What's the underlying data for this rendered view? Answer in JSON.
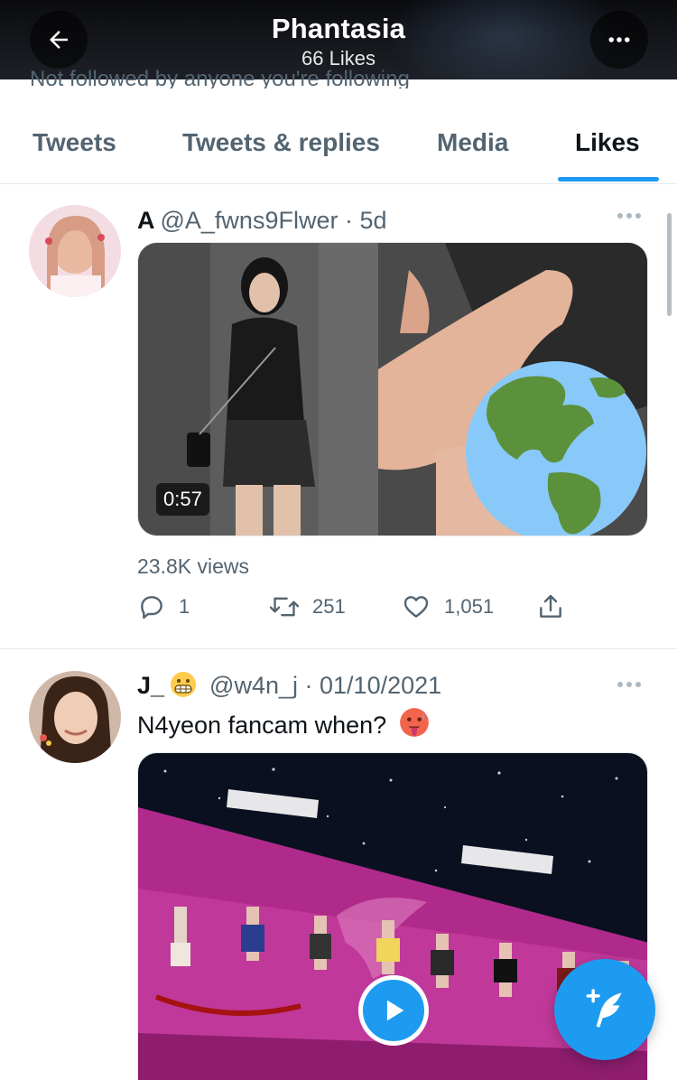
{
  "header": {
    "title": "Phantasia",
    "subtitle": "66 Likes",
    "back_icon": "arrow-left-icon",
    "more_icon": "more-horizontal-icon",
    "peek_text": "Not followed by anyone you're following"
  },
  "tabs": [
    {
      "label": "Tweets",
      "active": false
    },
    {
      "label": "Tweets & replies",
      "active": false
    },
    {
      "label": "Media",
      "active": false
    },
    {
      "label": "Likes",
      "active": true
    }
  ],
  "tweets": [
    {
      "name": "A",
      "handle": "@A_fwns9Flwer",
      "time": "5d",
      "video_duration": "0:57",
      "views": "23.8K views",
      "replies": "1",
      "retweets": "251",
      "likes": "1,051",
      "overlay_icon": "globe-americas-icon"
    },
    {
      "name": "J_",
      "handle": "@w4n_j",
      "time": "01/10/2021",
      "text": "N4yeon fancam when?",
      "name_emoji": "grimacing-face-icon",
      "text_emoji": "hot-face-icon"
    }
  ],
  "separator": "·",
  "colors": {
    "accent": "#1d9bf0",
    "secondary_text": "#536471",
    "primary_text": "#0f1419"
  }
}
